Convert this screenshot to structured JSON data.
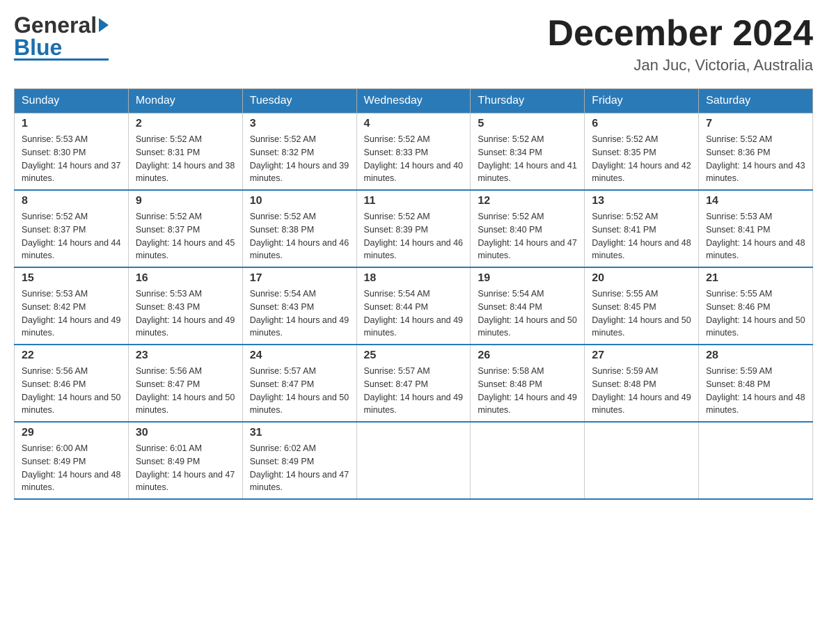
{
  "header": {
    "title": "December 2024",
    "subtitle": "Jan Juc, Victoria, Australia",
    "logo_general": "General",
    "logo_blue": "Blue"
  },
  "calendar": {
    "days_of_week": [
      "Sunday",
      "Monday",
      "Tuesday",
      "Wednesday",
      "Thursday",
      "Friday",
      "Saturday"
    ],
    "weeks": [
      [
        {
          "day": 1,
          "sunrise": "5:53 AM",
          "sunset": "8:30 PM",
          "daylight": "14 hours and 37 minutes."
        },
        {
          "day": 2,
          "sunrise": "5:52 AM",
          "sunset": "8:31 PM",
          "daylight": "14 hours and 38 minutes."
        },
        {
          "day": 3,
          "sunrise": "5:52 AM",
          "sunset": "8:32 PM",
          "daylight": "14 hours and 39 minutes."
        },
        {
          "day": 4,
          "sunrise": "5:52 AM",
          "sunset": "8:33 PM",
          "daylight": "14 hours and 40 minutes."
        },
        {
          "day": 5,
          "sunrise": "5:52 AM",
          "sunset": "8:34 PM",
          "daylight": "14 hours and 41 minutes."
        },
        {
          "day": 6,
          "sunrise": "5:52 AM",
          "sunset": "8:35 PM",
          "daylight": "14 hours and 42 minutes."
        },
        {
          "day": 7,
          "sunrise": "5:52 AM",
          "sunset": "8:36 PM",
          "daylight": "14 hours and 43 minutes."
        }
      ],
      [
        {
          "day": 8,
          "sunrise": "5:52 AM",
          "sunset": "8:37 PM",
          "daylight": "14 hours and 44 minutes."
        },
        {
          "day": 9,
          "sunrise": "5:52 AM",
          "sunset": "8:37 PM",
          "daylight": "14 hours and 45 minutes."
        },
        {
          "day": 10,
          "sunrise": "5:52 AM",
          "sunset": "8:38 PM",
          "daylight": "14 hours and 46 minutes."
        },
        {
          "day": 11,
          "sunrise": "5:52 AM",
          "sunset": "8:39 PM",
          "daylight": "14 hours and 46 minutes."
        },
        {
          "day": 12,
          "sunrise": "5:52 AM",
          "sunset": "8:40 PM",
          "daylight": "14 hours and 47 minutes."
        },
        {
          "day": 13,
          "sunrise": "5:52 AM",
          "sunset": "8:41 PM",
          "daylight": "14 hours and 48 minutes."
        },
        {
          "day": 14,
          "sunrise": "5:53 AM",
          "sunset": "8:41 PM",
          "daylight": "14 hours and 48 minutes."
        }
      ],
      [
        {
          "day": 15,
          "sunrise": "5:53 AM",
          "sunset": "8:42 PM",
          "daylight": "14 hours and 49 minutes."
        },
        {
          "day": 16,
          "sunrise": "5:53 AM",
          "sunset": "8:43 PM",
          "daylight": "14 hours and 49 minutes."
        },
        {
          "day": 17,
          "sunrise": "5:54 AM",
          "sunset": "8:43 PM",
          "daylight": "14 hours and 49 minutes."
        },
        {
          "day": 18,
          "sunrise": "5:54 AM",
          "sunset": "8:44 PM",
          "daylight": "14 hours and 49 minutes."
        },
        {
          "day": 19,
          "sunrise": "5:54 AM",
          "sunset": "8:44 PM",
          "daylight": "14 hours and 50 minutes."
        },
        {
          "day": 20,
          "sunrise": "5:55 AM",
          "sunset": "8:45 PM",
          "daylight": "14 hours and 50 minutes."
        },
        {
          "day": 21,
          "sunrise": "5:55 AM",
          "sunset": "8:46 PM",
          "daylight": "14 hours and 50 minutes."
        }
      ],
      [
        {
          "day": 22,
          "sunrise": "5:56 AM",
          "sunset": "8:46 PM",
          "daylight": "14 hours and 50 minutes."
        },
        {
          "day": 23,
          "sunrise": "5:56 AM",
          "sunset": "8:47 PM",
          "daylight": "14 hours and 50 minutes."
        },
        {
          "day": 24,
          "sunrise": "5:57 AM",
          "sunset": "8:47 PM",
          "daylight": "14 hours and 50 minutes."
        },
        {
          "day": 25,
          "sunrise": "5:57 AM",
          "sunset": "8:47 PM",
          "daylight": "14 hours and 49 minutes."
        },
        {
          "day": 26,
          "sunrise": "5:58 AM",
          "sunset": "8:48 PM",
          "daylight": "14 hours and 49 minutes."
        },
        {
          "day": 27,
          "sunrise": "5:59 AM",
          "sunset": "8:48 PM",
          "daylight": "14 hours and 49 minutes."
        },
        {
          "day": 28,
          "sunrise": "5:59 AM",
          "sunset": "8:48 PM",
          "daylight": "14 hours and 48 minutes."
        }
      ],
      [
        {
          "day": 29,
          "sunrise": "6:00 AM",
          "sunset": "8:49 PM",
          "daylight": "14 hours and 48 minutes."
        },
        {
          "day": 30,
          "sunrise": "6:01 AM",
          "sunset": "8:49 PM",
          "daylight": "14 hours and 47 minutes."
        },
        {
          "day": 31,
          "sunrise": "6:02 AM",
          "sunset": "8:49 PM",
          "daylight": "14 hours and 47 minutes."
        },
        null,
        null,
        null,
        null
      ]
    ]
  }
}
